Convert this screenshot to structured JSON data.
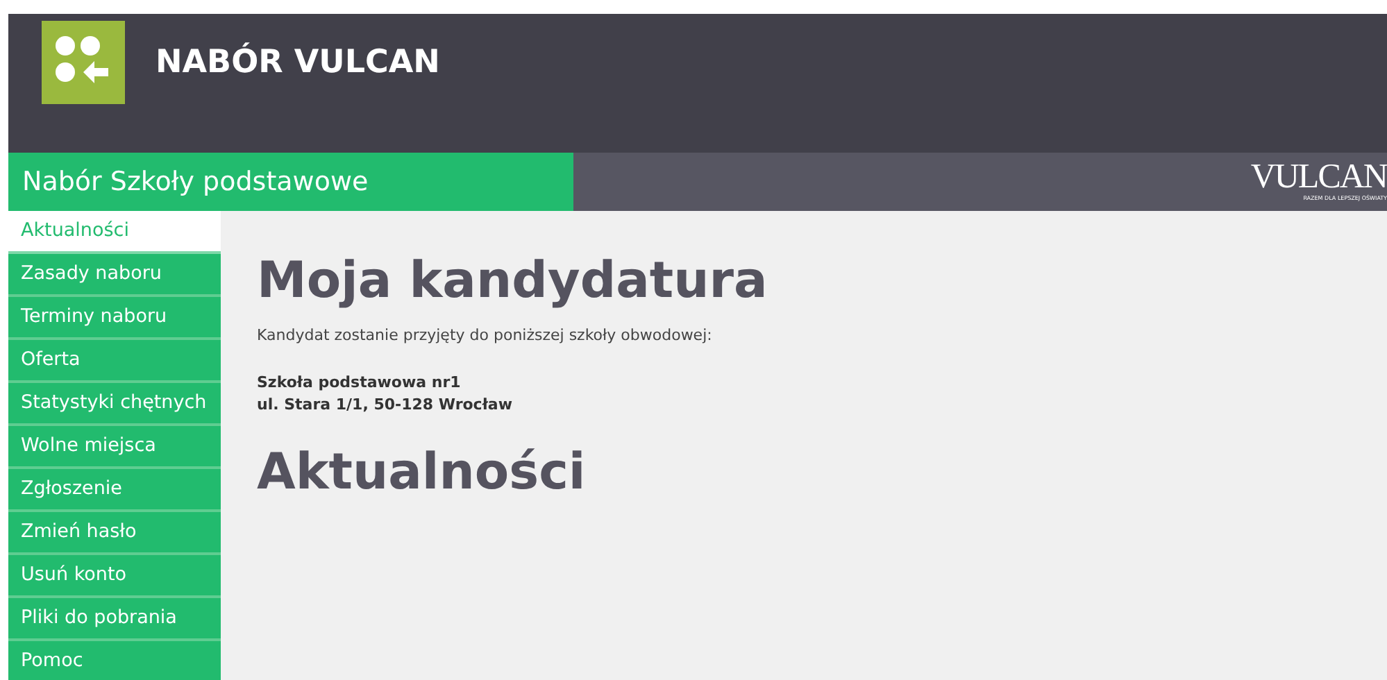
{
  "header": {
    "title": "NABÓR VULCAN"
  },
  "subheader": {
    "title": "Nabór Szkoły podstawowe",
    "brand": "VULCAN",
    "brand_tagline": "RAZEM DLA LEPSZEJ OŚWIATY"
  },
  "sidebar": {
    "items": [
      {
        "label": "Aktualności",
        "selected": true
      },
      {
        "label": "Zasady naboru",
        "selected": false
      },
      {
        "label": "Terminy naboru",
        "selected": false
      },
      {
        "label": "Oferta",
        "selected": false
      },
      {
        "label": "Statystyki chętnych",
        "selected": false
      },
      {
        "label": "Wolne miejsca",
        "selected": false
      },
      {
        "label": "Zgłoszenie",
        "selected": false
      },
      {
        "label": "Zmień hasło",
        "selected": false
      },
      {
        "label": "Usuń konto",
        "selected": false
      },
      {
        "label": "Pliki do pobrania",
        "selected": false
      },
      {
        "label": "Pomoc",
        "selected": false
      }
    ]
  },
  "main": {
    "heading": "Moja kandydatura",
    "intro": "Kandydat zostanie przyjęty do poniższej szkoły obwodowej:",
    "school_name": "Szkoła podstawowa nr1",
    "school_address": "ul. Stara 1/1, 50-128 Wrocław",
    "news_heading": "Aktualności"
  }
}
